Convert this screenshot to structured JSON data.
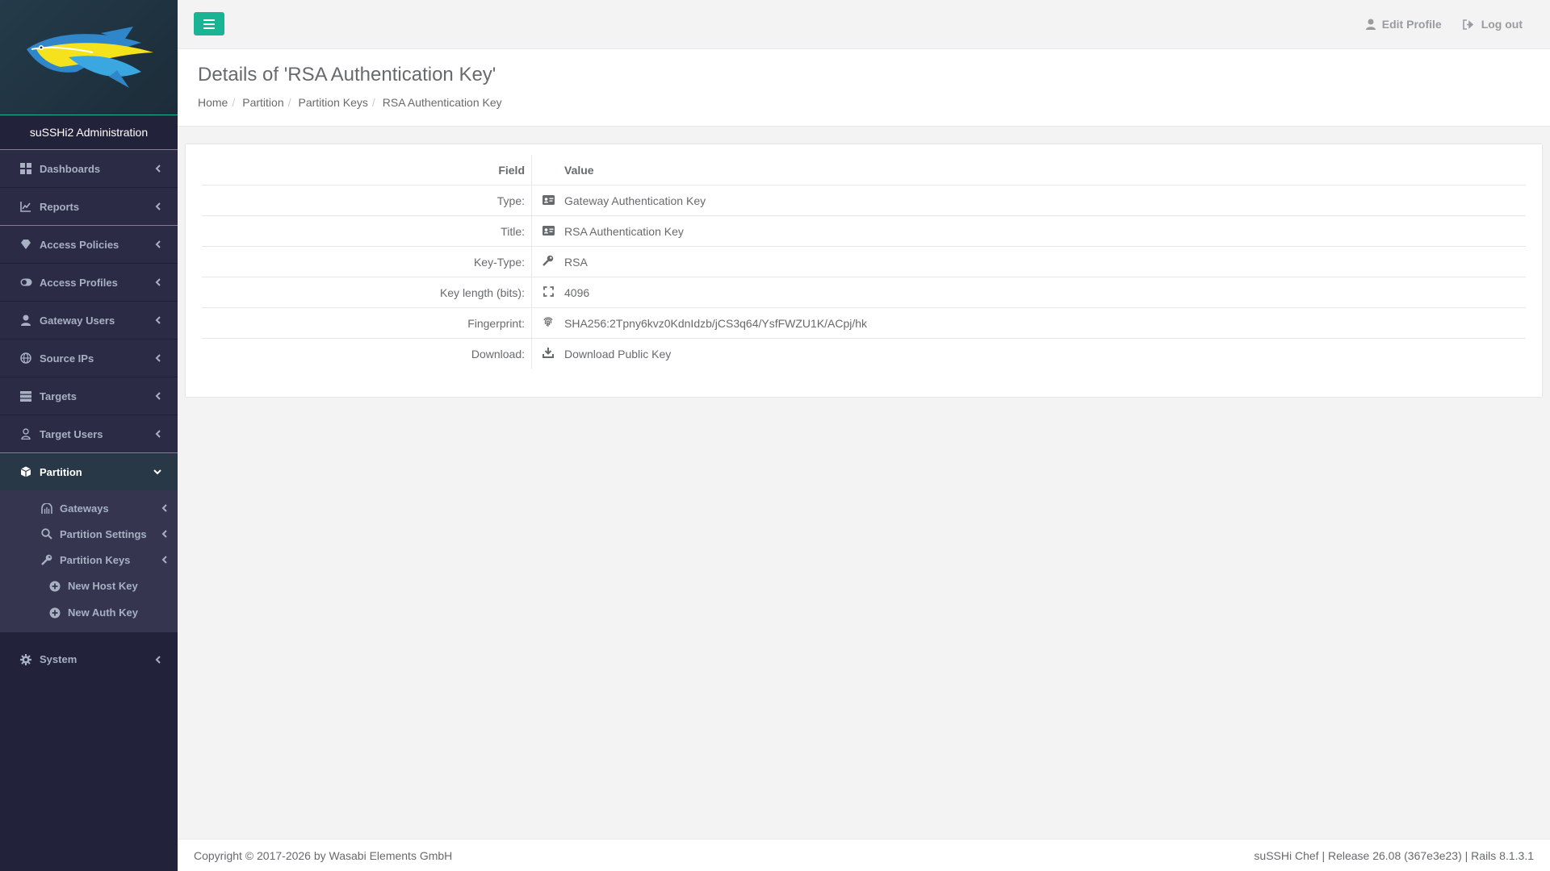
{
  "brand": {
    "title": "suSSHi2 Administration"
  },
  "sidebar": {
    "items": [
      {
        "label": "Dashboards",
        "icon": "dashboard-icon"
      },
      {
        "label": "Reports",
        "icon": "chart-icon"
      },
      {
        "label": "Access Policies",
        "icon": "diamond-icon"
      },
      {
        "label": "Access Profiles",
        "icon": "toggle-icon"
      },
      {
        "label": "Gateway Users",
        "icon": "user-icon"
      },
      {
        "label": "Source IPs",
        "icon": "globe-icon"
      },
      {
        "label": "Targets",
        "icon": "server-icon"
      },
      {
        "label": "Target Users",
        "icon": "user-outline-icon"
      },
      {
        "label": "Partition",
        "icon": "cube-icon"
      },
      {
        "label": "System",
        "icon": "gear-icon"
      }
    ],
    "partition_sub": [
      {
        "label": "Gateways",
        "icon": "dungeon-icon"
      },
      {
        "label": "Partition Settings",
        "icon": "search-icon"
      },
      {
        "label": "Partition Keys",
        "icon": "key-icon"
      }
    ],
    "keys_sub": [
      {
        "label": "New Host Key",
        "icon": "plus-circle-icon"
      },
      {
        "label": "New Auth Key",
        "icon": "plus-circle-icon"
      }
    ]
  },
  "topbar": {
    "edit_profile": "Edit Profile",
    "logout": "Log out"
  },
  "heading": {
    "title": "Details of 'RSA Authentication Key'",
    "breadcrumb": [
      "Home",
      "Partition",
      "Partition Keys",
      "RSA Authentication Key"
    ]
  },
  "details": {
    "headers": {
      "field": "Field",
      "value": "Value"
    },
    "rows": [
      {
        "field": "Type:",
        "icon": "id-card-icon",
        "value": "Gateway Authentication Key"
      },
      {
        "field": "Title:",
        "icon": "id-card-icon",
        "value": "RSA Authentication Key"
      },
      {
        "field": "Key-Type:",
        "icon": "key-icon",
        "value": "RSA"
      },
      {
        "field": "Key length (bits):",
        "icon": "expand-icon",
        "value": "4096"
      },
      {
        "field": "Fingerprint:",
        "icon": "fingerprint-icon",
        "value": "SHA256:2Tpny6kvz0KdnIdzb/jCS3q64/YsfFWZU1K/ACpj/hk"
      },
      {
        "field": "Download:",
        "icon": "download-icon",
        "value": "Download Public Key"
      }
    ]
  },
  "footer": {
    "copyright": "Copyright © 2017-2026 by Wasabi Elements GmbH",
    "release": "suSSHi Chef | Release 26.08 (367e3e23) | Rails 8.1.3.1"
  },
  "colors": {
    "accent": "#1ab394",
    "sidebar": "#22223a",
    "submenu": "#353550"
  }
}
